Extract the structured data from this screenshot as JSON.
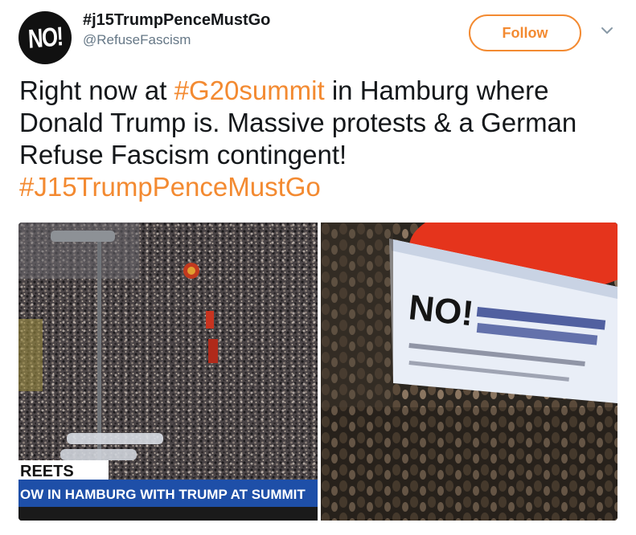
{
  "tweet": {
    "author": {
      "display_name": "#j15TrumpPenceMustGo",
      "handle": "@RefuseFascism",
      "avatar_text": "NO!"
    },
    "follow_label": "Follow",
    "menu_icon": "chevron-down-icon",
    "text_parts": [
      {
        "text": "Right now at ",
        "type": "text"
      },
      {
        "text": "#G20summit",
        "type": "hashtag"
      },
      {
        "text": " in Hamburg where Donald Trump is. Massive protests & a German Refuse Fascism contingent! ",
        "type": "text"
      },
      {
        "text": "#J15TrumpPenceMustGo",
        "type": "hashtag"
      }
    ],
    "media": {
      "left_photo": {
        "caption_top": "REETS",
        "caption_bottom": "OW IN HAMBURG WITH TRUMP AT SUMMIT"
      },
      "right_photo": {
        "banner_text": "NO!"
      }
    }
  },
  "colors": {
    "accent": "#f38a31",
    "text": "#14171a",
    "secondary": "#657786",
    "news_banner": "#1e4fa8"
  }
}
